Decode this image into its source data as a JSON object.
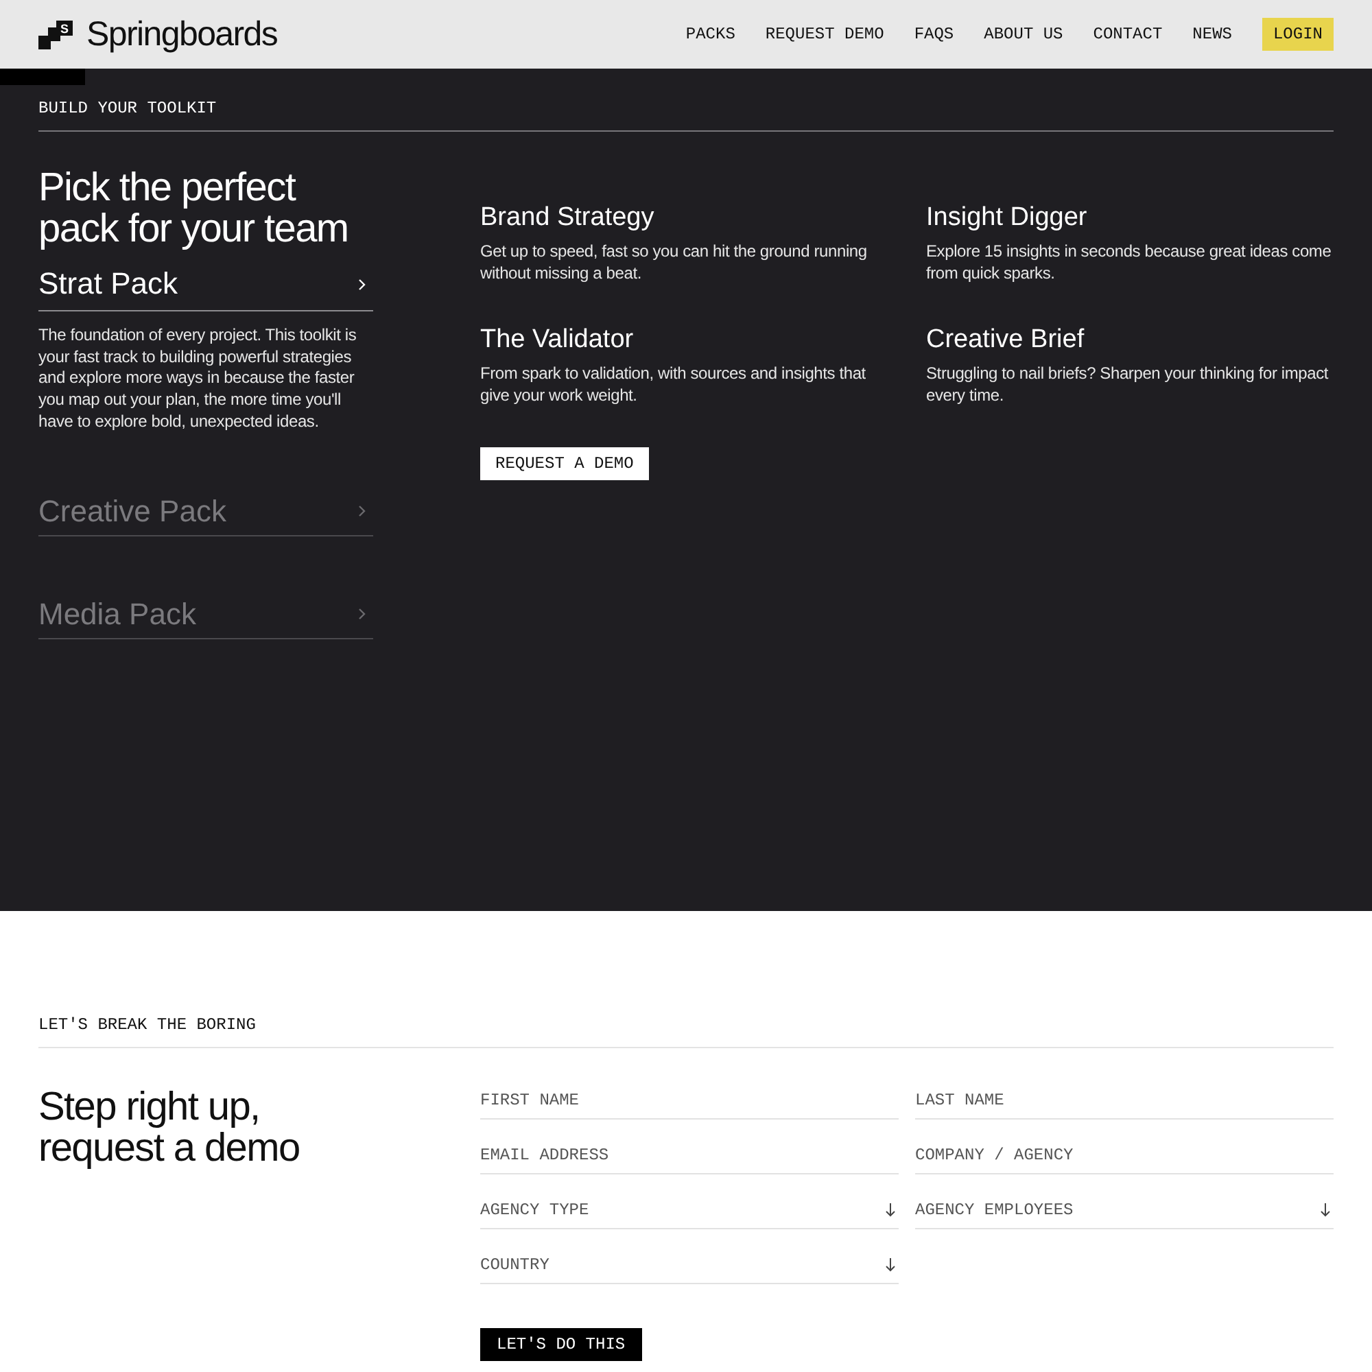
{
  "header": {
    "logo_text": "Springboards",
    "logo_mark": "S",
    "nav": [
      {
        "label": "PACKS",
        "kind": "link"
      },
      {
        "label": "REQUEST DEMO",
        "kind": "link"
      },
      {
        "label": "FAQS",
        "kind": "link"
      },
      {
        "label": "ABOUT US",
        "kind": "link"
      },
      {
        "label": "CONTACT",
        "kind": "link"
      },
      {
        "label": "NEWS",
        "kind": "link"
      },
      {
        "label": "LOGIN",
        "kind": "button"
      }
    ]
  },
  "toolkit": {
    "eyebrow": "BUILD YOUR TOOLKIT",
    "heading": "Pick the perfect pack for your team",
    "packs": [
      {
        "name": "Strat Pack",
        "expanded": true,
        "description": "The foundation of every project. This toolkit is your fast track to building powerful strategies and explore more ways in because the faster you map out your plan, the more time you'll have to explore bold, unexpected ideas."
      },
      {
        "name": "Creative Pack",
        "expanded": false
      },
      {
        "name": "Media Pack",
        "expanded": false
      }
    ],
    "features": [
      {
        "title": "Brand Strategy",
        "text": "Get up to speed, fast so you can hit the ground running without missing a beat."
      },
      {
        "title": "Insight Digger",
        "text": "Explore 15 insights in seconds because great ideas come from quick sparks."
      },
      {
        "title": "The Validator",
        "text": "From spark to validation, with sources and insights that give your work weight."
      },
      {
        "title": "Creative Brief",
        "text": "Struggling to nail briefs? Sharpen your thinking for impact every time."
      }
    ],
    "button": "REQUEST A DEMO"
  },
  "demo": {
    "eyebrow": "LET'S BREAK THE BORING",
    "heading": "Step right up, request a demo",
    "fields": [
      {
        "placeholder": "FIRST NAME",
        "kind": "text"
      },
      {
        "placeholder": "LAST NAME",
        "kind": "text"
      },
      {
        "placeholder": "EMAIL ADDRESS",
        "kind": "text"
      },
      {
        "placeholder": "COMPANY / AGENCY",
        "kind": "text"
      },
      {
        "placeholder": "AGENCY TYPE",
        "kind": "select"
      },
      {
        "placeholder": "AGENCY EMPLOYEES",
        "kind": "select"
      },
      {
        "placeholder": "COUNTRY",
        "kind": "select"
      }
    ],
    "submit": "LET'S DO THIS"
  }
}
